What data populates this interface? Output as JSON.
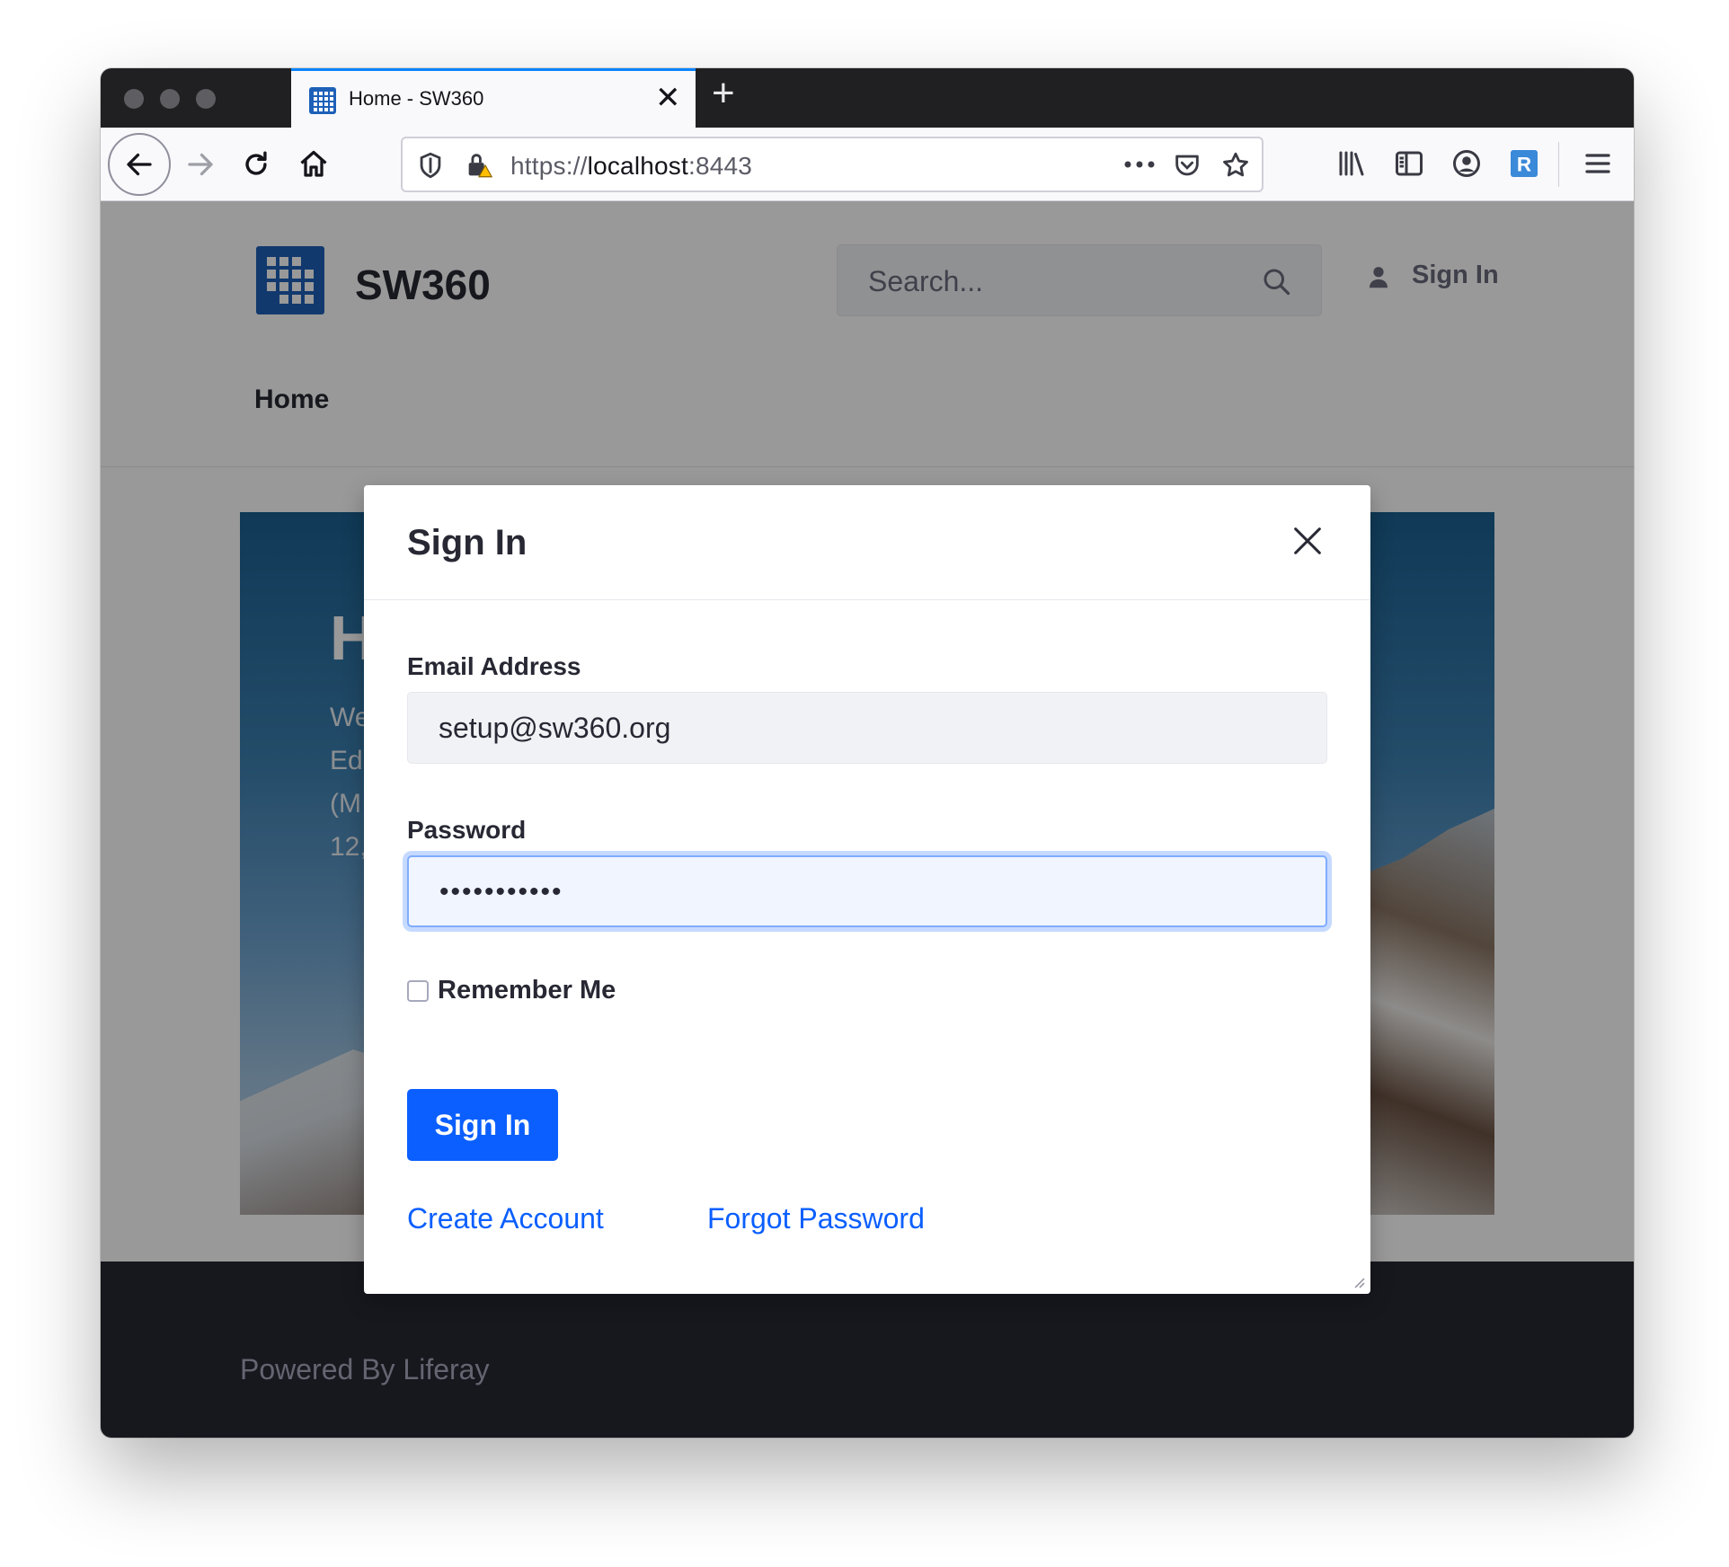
{
  "browser": {
    "tab_title": "Home - SW360",
    "tab_close_glyph": "✕",
    "new_tab_glyph": "+",
    "url_scheme": "https://",
    "url_host": "localhost",
    "url_port": ":8443",
    "accent_color": "#0a84ff"
  },
  "site": {
    "name": "SW360",
    "search_placeholder": "Search...",
    "header_signin": "Sign In",
    "nav": [
      "Home"
    ],
    "hero_title": "H",
    "hero_text_lines": [
      "We",
      "Ed",
      "(M",
      "12,"
    ],
    "footer": "Powered By Liferay",
    "brand_color": "#1d60b8"
  },
  "modal": {
    "title": "Sign In",
    "email_label": "Email Address",
    "email_value": "setup@sw360.org",
    "password_label": "Password",
    "password_value": "•••••••••••",
    "remember_label": "Remember Me",
    "remember_checked": false,
    "submit_label": "Sign In",
    "create_account": "Create Account",
    "forgot_password": "Forgot Password",
    "primary_color": "#0b5fff"
  }
}
